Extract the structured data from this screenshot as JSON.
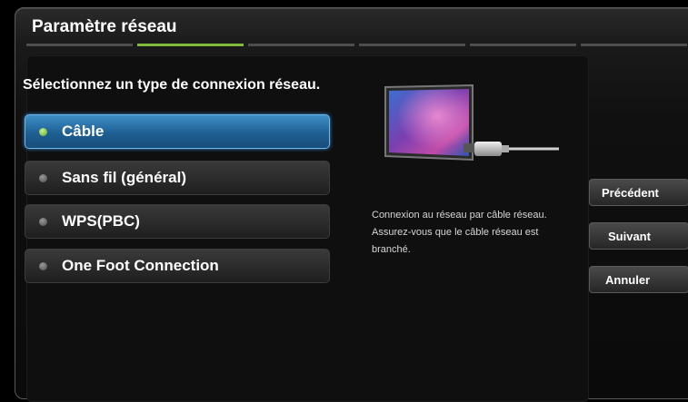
{
  "dialog": {
    "title": "Paramètre réseau",
    "steps_total": 6,
    "active_step": 2
  },
  "content": {
    "prompt": "Sélectionnez un type de connexion réseau.",
    "options": [
      {
        "label": "Câble",
        "selected": true
      },
      {
        "label": "Sans fil (général)",
        "selected": false
      },
      {
        "label": "WPS(PBC)",
        "selected": false
      },
      {
        "label": "One Foot Connection",
        "selected": false
      }
    ],
    "description": "Connexion au réseau par câble réseau. Assurez-vous que le câble réseau est branché."
  },
  "buttons": {
    "previous": "Précédent",
    "next": "Suivant",
    "cancel": "Annuler"
  },
  "colors": {
    "accent_green": "#7fba3a",
    "selection_blue": "#3e8fc7"
  }
}
